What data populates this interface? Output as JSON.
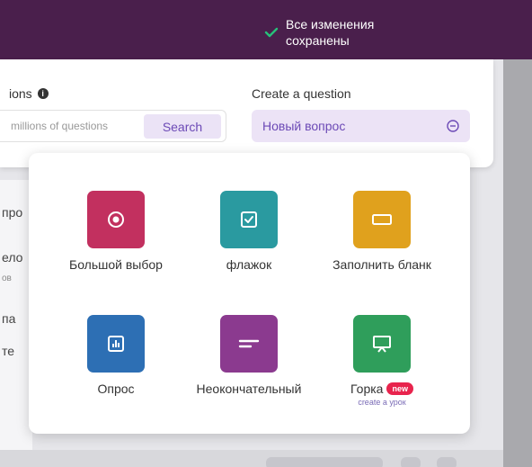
{
  "status": {
    "text_line1": "Все изменения",
    "text_line2": "сохранены"
  },
  "search": {
    "label": "ions",
    "input_placeholder": "millions of questions",
    "button_label": "Search"
  },
  "create": {
    "label": "Create a question",
    "value": "Новый вопрос"
  },
  "question_types": [
    {
      "label": "Большой выбор",
      "color": "#c2305f",
      "icon": "radio-icon"
    },
    {
      "label": "флажок",
      "color": "#2a9aa0",
      "icon": "checkbox-icon"
    },
    {
      "label": "Заполнить бланк",
      "color": "#e0a11d",
      "icon": "blank-icon"
    },
    {
      "label": "Опрос",
      "color": "#2d6fb4",
      "icon": "poll-icon"
    },
    {
      "label": "Неоконча­тельный",
      "color": "#8b3a8f",
      "icon": "open-ended-icon"
    },
    {
      "label": "Горка",
      "color": "#2f9e5b",
      "icon": "slide-icon",
      "badge": "new",
      "sub": "create a урок"
    }
  ],
  "background_fragments": [
    "про",
    "ело",
    "ов",
    "па",
    "те"
  ]
}
